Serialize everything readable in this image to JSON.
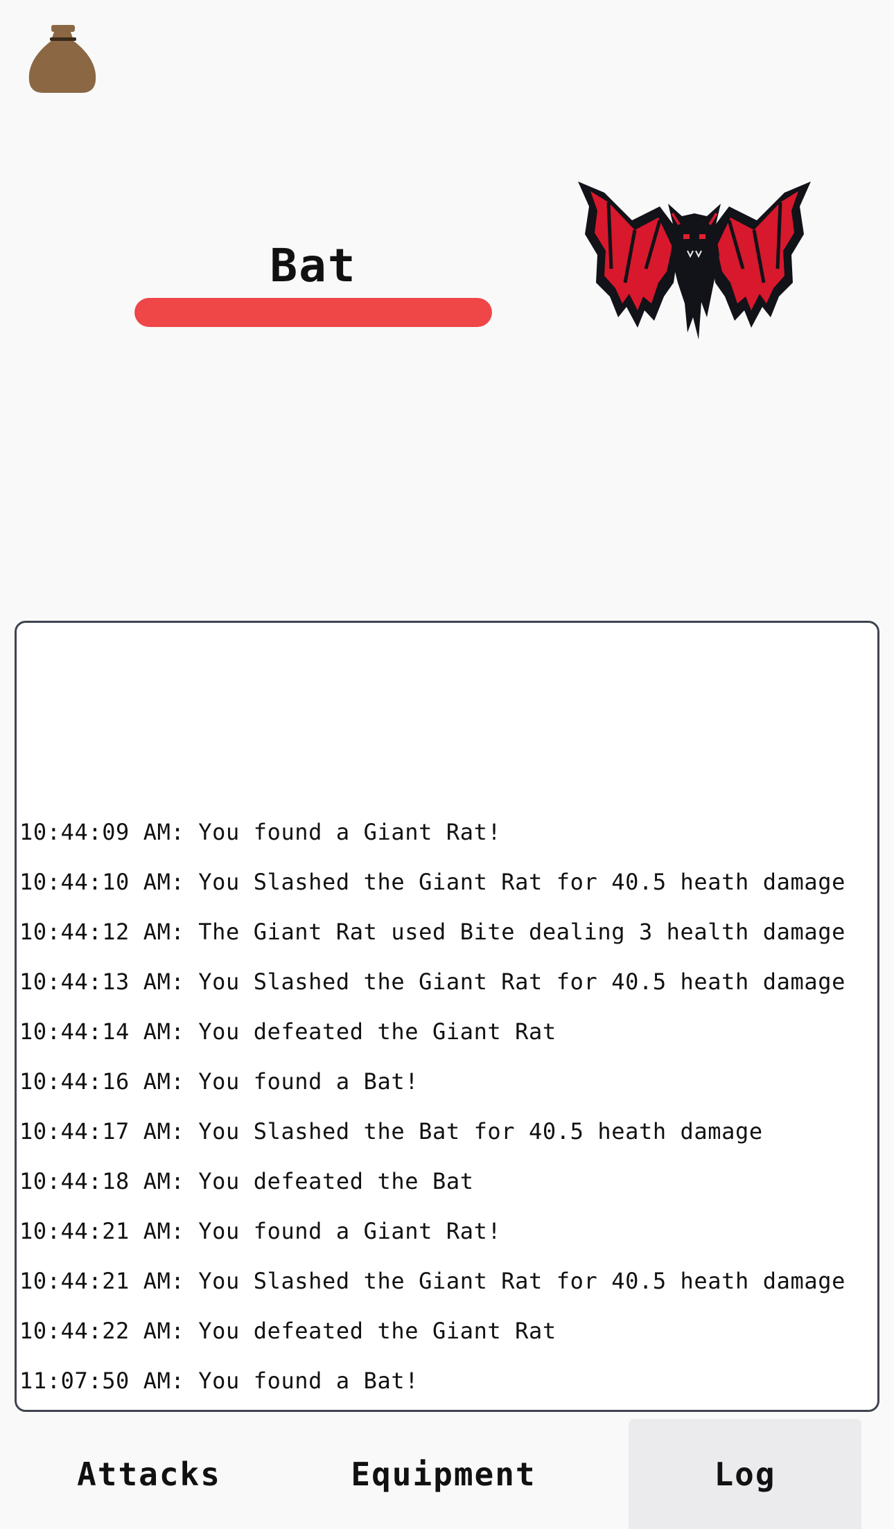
{
  "toolbar": {
    "inventory_icon": "money-bag-icon"
  },
  "enemy": {
    "name": "Bat",
    "health_fraction": 1.0,
    "health_color": "#ef4647",
    "sprite_icon": "bat-sprite"
  },
  "log": {
    "entries": [
      "10:44:09 AM: You found a Giant Rat!",
      "10:44:10 AM: You Slashed the Giant Rat for 40.5 heath damage",
      "10:44:12 AM: The Giant Rat used Bite dealing 3 health damage",
      "10:44:13 AM: You Slashed the Giant Rat for 40.5 heath damage",
      "10:44:14 AM: You defeated the Giant Rat",
      "10:44:16 AM: You found a Bat!",
      "10:44:17 AM: You Slashed the Bat for 40.5 heath damage",
      "10:44:18 AM: You defeated the Bat",
      "10:44:21 AM: You found a Giant Rat!",
      "10:44:21 AM: You Slashed the Giant Rat for 40.5 heath damage",
      "10:44:22 AM: You defeated the Giant Rat",
      "11:07:50 AM: You found a Bat!"
    ]
  },
  "tabs": {
    "attacks": "Attacks",
    "equipment": "Equipment",
    "log": "Log",
    "active": "log"
  }
}
